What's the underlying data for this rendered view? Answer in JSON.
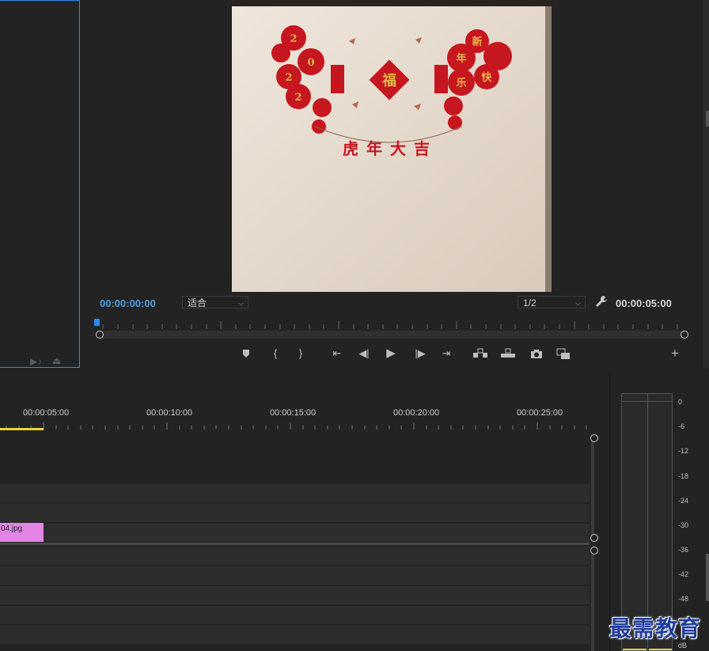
{
  "program_monitor": {
    "current_timecode": "00:00:00:00",
    "duration_timecode": "00:00:05:00",
    "zoom_select": "适合",
    "resolution_select": "1/2",
    "frame_banner_text": "虎年大吉"
  },
  "transport_icons": [
    "add-marker-icon",
    "mark-in-icon",
    "mark-out-icon",
    "go-to-in-icon",
    "step-back-icon",
    "play-icon",
    "step-forward-icon",
    "go-to-out-icon",
    "lift-icon",
    "extract-icon",
    "export-frame-icon",
    "comparison-view-icon",
    "add-button-icon"
  ],
  "timeline": {
    "ruler_labels": [
      "00:00:05:00",
      "00:00:10:00",
      "00:00:15:00",
      "00:00:20:00",
      "00:00:25:00"
    ],
    "clip_name": "04.jpg"
  },
  "audio_meter": {
    "scale": [
      "0",
      "-6",
      "-12",
      "-18",
      "-24",
      "-30",
      "-36",
      "-42",
      "-48",
      "dB"
    ]
  },
  "watermark": "最需教育",
  "colors": {
    "accent": "#2d8ceb",
    "clip": "#e285e4",
    "work_area": "#e7d13a",
    "timecode": "#4b9fe8"
  }
}
